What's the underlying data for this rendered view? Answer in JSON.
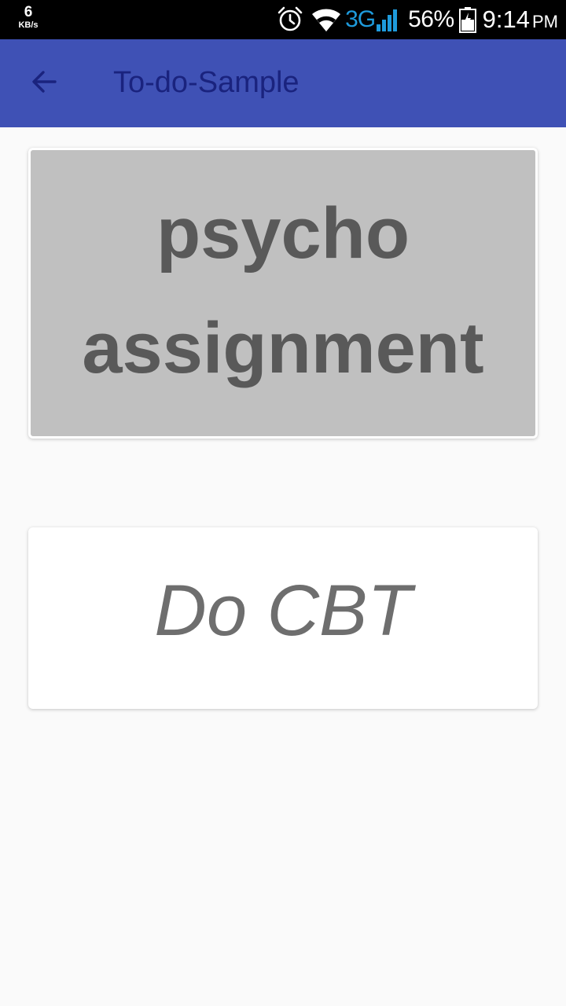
{
  "status_bar": {
    "net_speed_value": "6",
    "net_speed_unit": "KB/s",
    "icons": [
      "alarm-icon",
      "wifi-icon",
      "signal-icon",
      "battery-icon"
    ],
    "network_type": "3G",
    "battery_percent": "56%",
    "time": "9:14",
    "time_period": "PM"
  },
  "app_bar": {
    "back_icon": "arrow-back-icon",
    "title": "To-do-Sample",
    "color": "#3f51b5"
  },
  "todo_items": [
    {
      "text": "psycho assignment",
      "state": "done",
      "background": "#c0c0c0"
    },
    {
      "text": "Do CBT",
      "state": "pending",
      "background": "#ffffff"
    }
  ]
}
